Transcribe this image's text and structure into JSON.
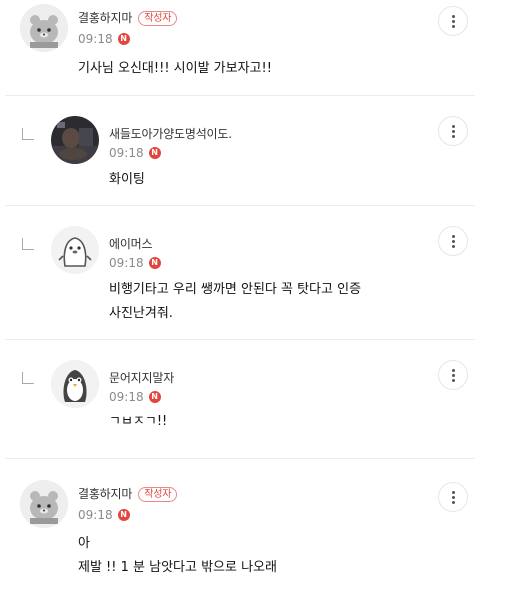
{
  "comments": [
    {
      "nickname": "결홍하지마",
      "author_badge": "작성자",
      "time": "09:18",
      "new_badge": "N",
      "lines": [
        "기사님 오신대!!! 시이발 가보자고!!"
      ],
      "avatar": "bear-icon",
      "reply": false
    },
    {
      "nickname": "새들도아가양도명석이도.",
      "time": "09:18",
      "new_badge": "N",
      "lines": [
        "화이팅"
      ],
      "avatar": "photo-avatar",
      "reply": true
    },
    {
      "nickname": "에이머스",
      "time": "09:18",
      "new_badge": "N",
      "lines": [
        "비행기타고 우리 쌩까면 안된다 꼭 탓다고 인증",
        "사진난겨줘."
      ],
      "avatar": "seal-icon",
      "reply": true
    },
    {
      "nickname": "문어지지말자",
      "time": "09:18",
      "new_badge": "N",
      "lines": [
        "ㄱㅂㅈㄱ!!"
      ],
      "avatar": "penguin-icon",
      "reply": true
    },
    {
      "nickname": "결홍하지마",
      "author_badge": "작성자",
      "time": "09:18",
      "new_badge": "N",
      "lines": [
        "아",
        "제발 !! 1 분 남앗다고 밖으로 나오래"
      ],
      "avatar": "bear-icon",
      "reply": false
    }
  ],
  "colors": {
    "accent_red": "#e2453c",
    "meta_gray": "#8a8a8a",
    "divider": "#ececec"
  }
}
